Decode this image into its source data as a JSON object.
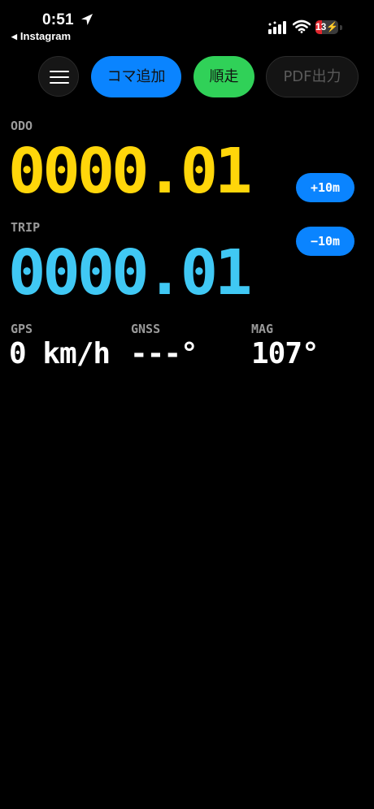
{
  "status_bar": {
    "time": "0:51",
    "back_app": "Instagram",
    "battery_level": "13",
    "battery_fraction": 0.13,
    "icons": [
      "location-arrow-icon",
      "cellular-signal-icon",
      "wifi-icon",
      "battery-charging-icon"
    ]
  },
  "toolbar": {
    "menu_icon": "hamburger-menu-icon",
    "add_frame_label": "コマ追加",
    "sequential_label": "順走",
    "pdf_export_label": "PDF出力",
    "colors": {
      "add_frame": "#0a84ff",
      "sequential": "#30d158",
      "pdf_export_disabled": "#141414"
    }
  },
  "odo": {
    "label": "ODO",
    "value": "0000.01",
    "color": "#ffd60a"
  },
  "trip": {
    "label": "TRIP",
    "value": "0000.01",
    "color": "#40c8f4"
  },
  "adjust": {
    "plus_label": "+10m",
    "minus_label": "−10m"
  },
  "metrics": {
    "gps_label": "GPS",
    "gps_value": "0 km/h",
    "gnss_label": "GNSS",
    "gnss_value": "---°",
    "mag_label": "MAG",
    "mag_value": "107°"
  }
}
